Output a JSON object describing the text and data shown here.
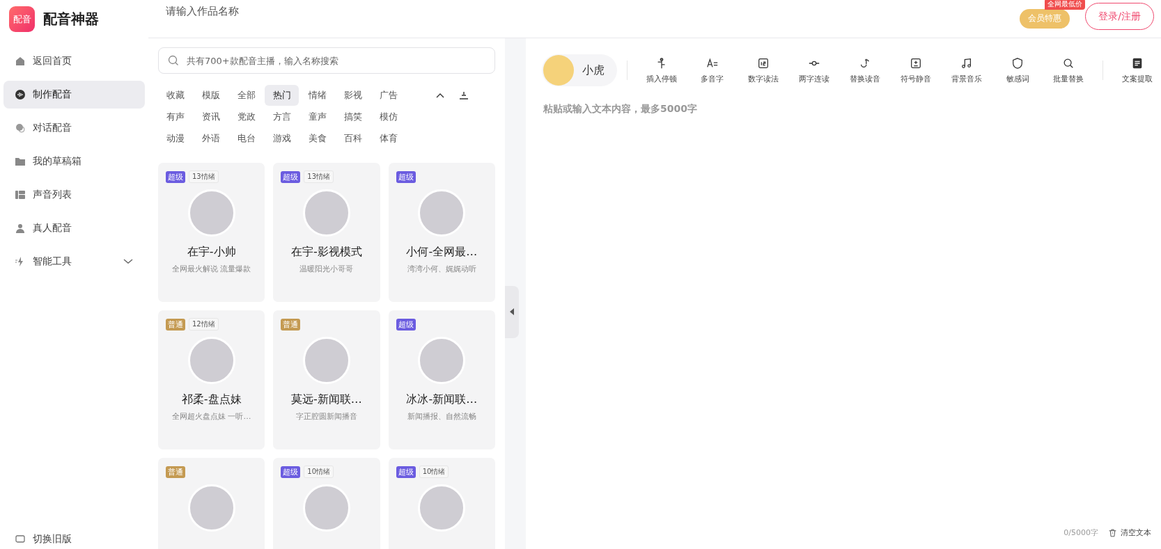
{
  "logo": {
    "mark": "配音",
    "title": "配音神器"
  },
  "sidebar": {
    "items": [
      {
        "label": "返回首页",
        "selected": false
      },
      {
        "label": "制作配音",
        "selected": true
      },
      {
        "label": "对话配音",
        "selected": false
      },
      {
        "label": "我的草稿箱",
        "selected": false
      },
      {
        "label": "声音列表",
        "selected": false
      },
      {
        "label": "真人配音",
        "selected": false
      },
      {
        "label": "智能工具",
        "selected": false,
        "expanded": false
      }
    ],
    "footer": "切换旧版"
  },
  "header": {
    "title_placeholder": "请输入作品名称",
    "vip": {
      "label": "会员特惠",
      "badge": "全网最低价"
    },
    "login": "登录/注册"
  },
  "voice_search": {
    "placeholder": "共有700+款配音主播，输入名称搜索"
  },
  "categories": [
    {
      "label": "收藏",
      "selected": false
    },
    {
      "label": "模版",
      "selected": false
    },
    {
      "label": "全部",
      "selected": false
    },
    {
      "label": "热门",
      "selected": true
    },
    {
      "label": "情绪",
      "selected": false
    },
    {
      "label": "影视",
      "selected": false
    },
    {
      "label": "广告",
      "selected": false
    },
    {
      "label": "有声",
      "selected": false
    },
    {
      "label": "资讯",
      "selected": false
    },
    {
      "label": "党政",
      "selected": false
    },
    {
      "label": "方言",
      "selected": false
    },
    {
      "label": "童声",
      "selected": false
    },
    {
      "label": "搞笑",
      "selected": false
    },
    {
      "label": "模仿",
      "selected": false
    },
    {
      "label": "动漫",
      "selected": false
    },
    {
      "label": "外语",
      "selected": false
    },
    {
      "label": "电台",
      "selected": false
    },
    {
      "label": "游戏",
      "selected": false
    },
    {
      "label": "美食",
      "selected": false
    },
    {
      "label": "百科",
      "selected": false
    },
    {
      "label": "体育",
      "selected": false
    }
  ],
  "voices": [
    {
      "tier": "超级",
      "kind": "super",
      "emotions": "13情绪",
      "name": "在宇-小帅",
      "desc": "全网最火解说 流量爆款"
    },
    {
      "tier": "超级",
      "kind": "super",
      "emotions": "13情绪",
      "name": "在宇-影视模式",
      "desc": "温暖阳光小哥哥"
    },
    {
      "tier": "超级",
      "kind": "super",
      "name": "小何-全网最…",
      "desc": "湾湾小何、娓娓动听"
    },
    {
      "tier": "普通",
      "kind": "normal",
      "emotions": "12情绪",
      "name": "祁柔-盘点妹",
      "desc": "全网超火盘点妹 一听…"
    },
    {
      "tier": "普通",
      "kind": "normal",
      "name": "莫远-新闻联…",
      "desc": "字正腔圆新闻播音"
    },
    {
      "tier": "超级",
      "kind": "super",
      "name": "冰冰-新闻联…",
      "desc": "新闻播报、自然流畅"
    },
    {
      "tier": "普通",
      "kind": "normal"
    },
    {
      "tier": "超级",
      "kind": "super",
      "emotions": "10情绪"
    },
    {
      "tier": "超级",
      "kind": "super",
      "emotions": "10情绪"
    }
  ],
  "editor": {
    "voice": "小虎",
    "tools": [
      "插入停顿",
      "多音字",
      "数字读法",
      "两字连读",
      "替换读音",
      "符号静音",
      "背景音乐",
      "敏感词",
      "批量替换"
    ],
    "extract": "文案提取",
    "placeholder": "粘贴或输入文本内容，最多5000字",
    "counter": "0/5000字",
    "clear": "清空文本"
  }
}
